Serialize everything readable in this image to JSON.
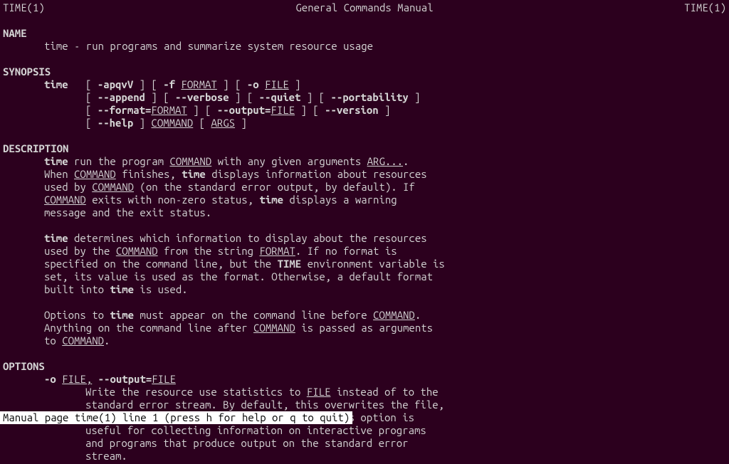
{
  "header": {
    "left": "TIME(1)",
    "center": "General Commands Manual",
    "right": "TIME(1)"
  },
  "sections": {
    "name": {
      "heading": "NAME",
      "text": "time - run programs and summarize system resource usage"
    },
    "synopsis": {
      "heading": "SYNOPSIS",
      "cmd": "time",
      "lines": {
        "l1a": "[ ",
        "l1b": "-apqvV",
        "l1c": " ] [ ",
        "l1d": "-f",
        "l1e": " ",
        "l1f": "FORMAT",
        "l1g": " ] [ ",
        "l1h": "-o",
        "l1i": " ",
        "l1j": "FILE",
        "l1k": " ]",
        "l2a": "[ ",
        "l2b": "--append",
        "l2c": " ] [ ",
        "l2d": "--verbose",
        "l2e": " ] [ ",
        "l2f": "--quiet",
        "l2g": " ] [ ",
        "l2h": "--portability",
        "l2i": " ]",
        "l3a": "[ ",
        "l3b": "--format=",
        "l3c": "FORMAT",
        "l3d": " ] [ ",
        "l3e": "--output=",
        "l3f": "FILE",
        "l3g": " ] [ ",
        "l3h": "--version",
        "l3i": " ]",
        "l4a": "[ ",
        "l4b": "--help",
        "l4c": " ] ",
        "l4d": "COMMAND",
        "l4e": " [ ",
        "l4f": "ARGS",
        "l4g": " ]"
      }
    },
    "description": {
      "heading": "DESCRIPTION",
      "p1": {
        "t1": "time",
        "t2": " run the program ",
        "t3": "COMMAND",
        "t4": " with any given arguments ",
        "t5": "ARG...",
        "t6": ".  When ",
        "t7": "COMMAND",
        "t8": " finishes, ",
        "t9": "time",
        "t10": " displays information about resources used by ",
        "t11": "COMMAND",
        "t12": " (on the standard error output, by default).  If ",
        "t13": "COMMAND",
        "t14": " exits with non-zero status, ",
        "t15": "time",
        "t16": " displays a warning message and the exit status."
      },
      "p2": {
        "t1": "time",
        "t2": " determines which information to display about the resources used by the ",
        "t3": "COMMAND",
        "t4": " from the string ",
        "t5": "FORMAT",
        "t6": ".  If no format is specified on the command line, but the ",
        "t7": "TIME",
        "t8": " environment variable is set, its value is used as the format.  Otherwise, a default format built into ",
        "t9": "time",
        "t10": " is used."
      },
      "p3": {
        "t1": "Options to ",
        "t2": "time",
        "t3": " must appear on the command line before ",
        "t4": "COMMAND",
        "t5": ".  Anything on the command line after ",
        "t6": "COMMAND",
        "t7": " is passed as arguments to ",
        "t8": "COMMAND",
        "t9": "."
      }
    },
    "options": {
      "heading": "OPTIONS",
      "opt1": {
        "flag1": "-o",
        "arg1": "FILE,",
        "sep": " ",
        "flag2": "--output=",
        "arg2": "FILE",
        "body": {
          "t1": "Write the resource use statistics to ",
          "t2": "FILE",
          "t3": " instead of to the standard error stream.  By default, this overwrites the file, destroying the file's previous contents.  This option is useful for collecting information on interactive programs and programs that produce output on the standard error stream."
        }
      }
    }
  },
  "statusbar": "Manual page time(1) line 1 (press h for help or q to quit)"
}
